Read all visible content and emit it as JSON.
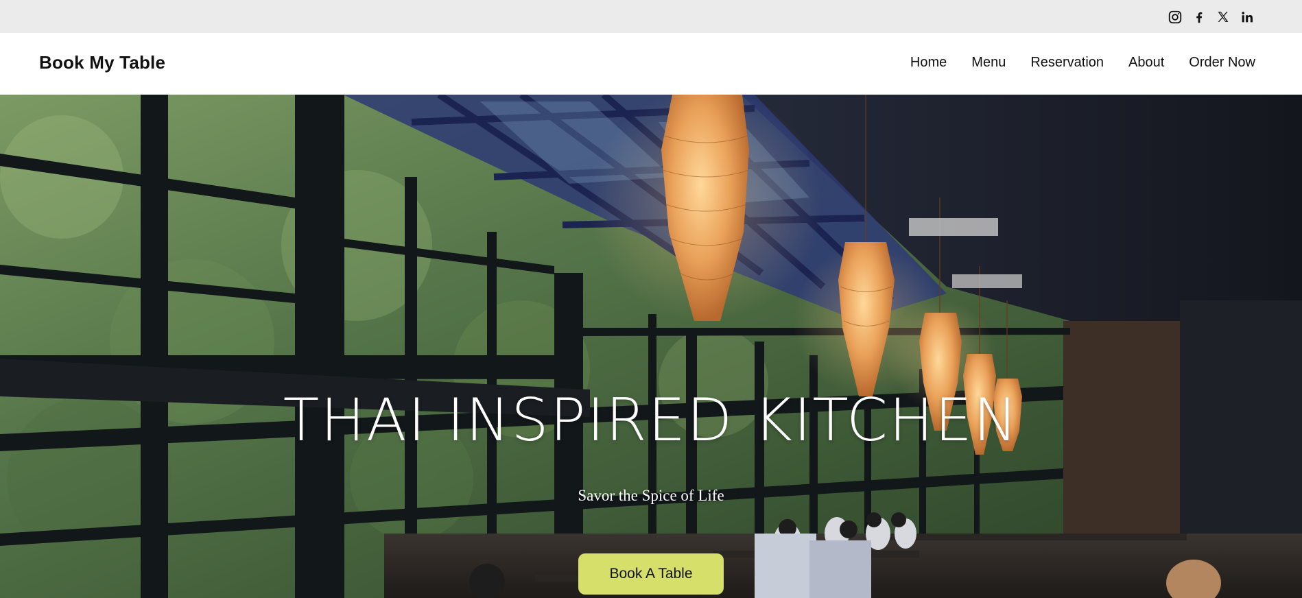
{
  "social": {
    "items": [
      {
        "name": "instagram",
        "icon": "instagram-icon"
      },
      {
        "name": "facebook",
        "icon": "facebook-icon"
      },
      {
        "name": "x",
        "icon": "x-icon"
      },
      {
        "name": "linkedin",
        "icon": "linkedin-icon"
      }
    ]
  },
  "header": {
    "brand": "Book My Table",
    "nav": [
      "Home",
      "Menu",
      "Reservation",
      "About",
      "Order Now"
    ]
  },
  "hero": {
    "title": "THAI INSPIRED KITCHEN",
    "subtitle": "Savor the Spice of Life",
    "cta_label": "Book A Table"
  },
  "colors": {
    "topbar": "#ebebeb",
    "header": "#ffffff",
    "cta": "#d6df6a",
    "hero_text": "#ffffff"
  }
}
